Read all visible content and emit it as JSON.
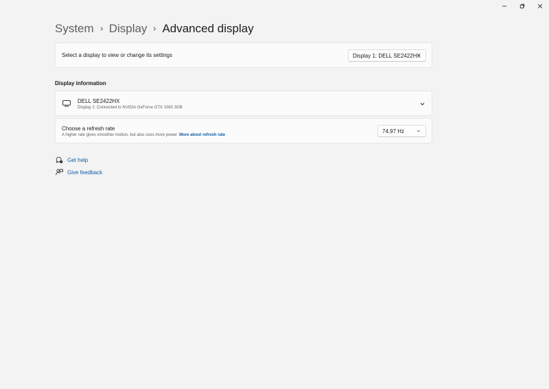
{
  "window": {
    "controls": [
      {
        "name": "minimize-icon"
      },
      {
        "name": "restore-icon"
      },
      {
        "name": "close-icon"
      }
    ]
  },
  "breadcrumb": {
    "items": [
      "System",
      "Display",
      "Advanced display"
    ]
  },
  "select_display": {
    "label": "Select a display to view or change its settings",
    "dropdown_value": "Display 1: DELL SE2422HX"
  },
  "display_information": {
    "section_title": "Display information",
    "monitor": {
      "icon": "monitor-icon",
      "name": "DELL SE2422HX",
      "subtitle": "Display 1: Connected to NVIDIA GeForce GTX 1060 3GB"
    }
  },
  "refresh_rate": {
    "title": "Choose a refresh rate",
    "description": "A higher rate gives smoother motion, but also uses more power",
    "link": "More about refresh rate",
    "dropdown_value": "74.97 Hz"
  },
  "help": {
    "get_help": "Get help",
    "give_feedback": "Give feedback"
  },
  "colors": {
    "background": "#f3f3f3",
    "card": "#fbfbfb",
    "accent_link": "#0f5ea8"
  }
}
